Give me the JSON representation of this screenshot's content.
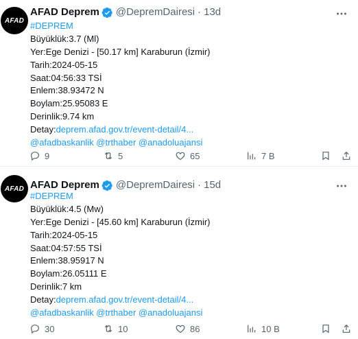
{
  "tweets": [
    {
      "avatar_text": "AFAD",
      "name": "AFAD Deprem",
      "handle": "@DepremDairesi",
      "time": "13d",
      "lines": {
        "hashtag": "#DEPREM",
        "magnitude": "Büyüklük:3.7 (Ml)",
        "location": "Yer:Ege Denizi - [50.17 km] Karaburun (İzmir)",
        "date": "Tarih:2024-05-15",
        "hour": "Saat:04:56:33 TSİ",
        "lat": "Enlem:38.93472 N",
        "lon": "Boylam:25.95083 E",
        "depth": "Derinlik:9.74 km",
        "detail_label": "Detay:",
        "detail_link": "deprem.afad.gov.tr/event-detail/4...",
        "mentions": "@afadbaskanlik @trthaber @anadoluajansi"
      },
      "stats": {
        "replies": "9",
        "reposts": "5",
        "likes": "65",
        "views": "7 B"
      }
    },
    {
      "avatar_text": "AFAD",
      "name": "AFAD Deprem",
      "handle": "@DepremDairesi",
      "time": "15d",
      "lines": {
        "hashtag": "#DEPREM",
        "magnitude": "Büyüklük:4.5 (Mw)",
        "location": "Yer:Ege Denizi - [45.60 km] Karaburun (İzmir)",
        "date": "Tarih:2024-05-15",
        "hour": "Saat:04:57:55 TSİ",
        "lat": "Enlem:38.95917 N",
        "lon": "Boylam:26.05111 E",
        "depth": "Derinlik:7 km",
        "detail_label": "Detay:",
        "detail_link": "deprem.afad.gov.tr/event-detail/4...",
        "mentions": "@afadbaskanlik @trthaber @anadoluajansi"
      },
      "stats": {
        "replies": "30",
        "reposts": "10",
        "likes": "86",
        "views": "10 B"
      }
    }
  ],
  "colors": {
    "link": "#1d9bf0",
    "muted": "#536471",
    "text": "#0f1419",
    "verified_badge": "#1d9bf0",
    "divider": "#eff3f4"
  },
  "icons": [
    "verified-badge-icon",
    "more-icon",
    "reply-icon",
    "repost-icon",
    "like-icon",
    "views-icon",
    "bookmark-icon",
    "share-icon"
  ]
}
